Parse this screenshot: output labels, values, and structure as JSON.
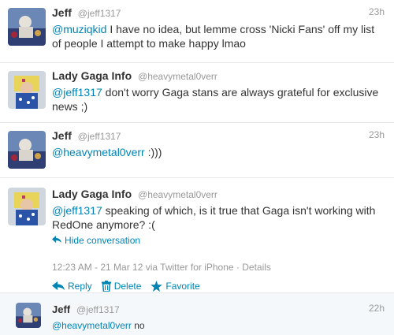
{
  "tweets": [
    {
      "fullname": "Jeff",
      "username": "@jeff1317",
      "time": "23h",
      "mention": "@muziqkid",
      "text": " I have no idea, but lemme cross 'Nicki Fans' off my list of people I attempt to make happy lmao"
    },
    {
      "fullname": "Lady Gaga Info",
      "username": "@heavymetal0verr",
      "time": "",
      "mention": "@jeff1317",
      "text": " don't worry Gaga stans are always grateful for exclusive news ;)"
    },
    {
      "fullname": "Jeff",
      "username": "@jeff1317",
      "time": "23h",
      "mention": "@heavymetal0verr",
      "text": " :)))"
    },
    {
      "fullname": "Lady Gaga Info",
      "username": "@heavymetal0verr",
      "time": "",
      "mention": "@jeff1317",
      "text": " speaking of which, is it true that Gaga isn't working with RedOne anymore? :(",
      "hide_conversation": "Hide conversation",
      "meta": "12:23 AM - 21 Mar 12 via Twitter for iPhone · Details",
      "actions": {
        "reply": "Reply",
        "delete": "Delete",
        "favorite": "Favorite"
      }
    },
    {
      "fullname": "Jeff",
      "username": "@jeff1317",
      "time": "22h",
      "mention": "@heavymetal0verr",
      "text": " no"
    }
  ],
  "colors": {
    "link": "#0084b4",
    "muted": "#999999",
    "text": "#333333"
  },
  "icons": [
    "reply-icon",
    "delete-icon",
    "favorite-icon",
    "hide-conversation-icon"
  ]
}
